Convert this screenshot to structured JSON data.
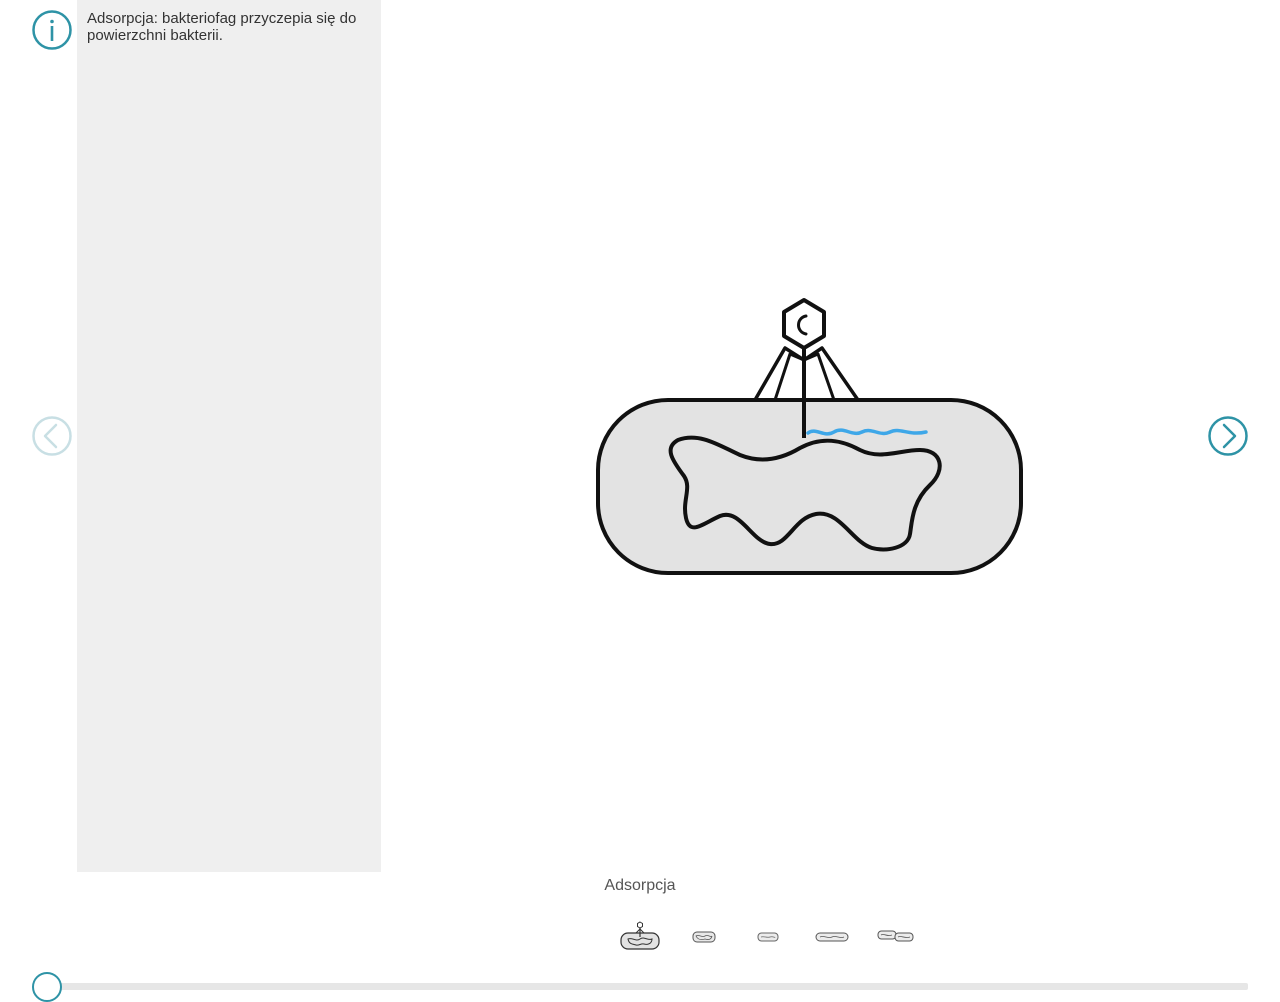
{
  "info": {
    "icon": "info-icon",
    "description": "Adsorpcja: bakteriofag przyczepia się do powierzchni bakterii."
  },
  "navigation": {
    "prev_icon": "chevron-left-circle-icon",
    "next_icon": "chevron-right-circle-icon",
    "prev_enabled": false,
    "next_enabled": true
  },
  "step": {
    "caption": "Adsorpcja",
    "current_index": 0
  },
  "thumbnails": [
    {
      "icon": "adsorption-thumbnail-icon",
      "selected": true
    },
    {
      "icon": "injection-thumbnail-icon",
      "selected": false
    },
    {
      "icon": "replication-thumbnail-icon",
      "selected": false
    },
    {
      "icon": "elongated-cell-thumbnail-icon",
      "selected": false
    },
    {
      "icon": "division-thumbnail-icon",
      "selected": false
    }
  ],
  "slider": {
    "progress": 0
  },
  "colors": {
    "accent": "#2e93a6",
    "accent_disabled": "#c8dfe4",
    "panel_bg": "#efefef",
    "cell_fill": "#e3e3e3",
    "dna_highlight": "#3ea7e8",
    "track": "#e6e6e6"
  }
}
